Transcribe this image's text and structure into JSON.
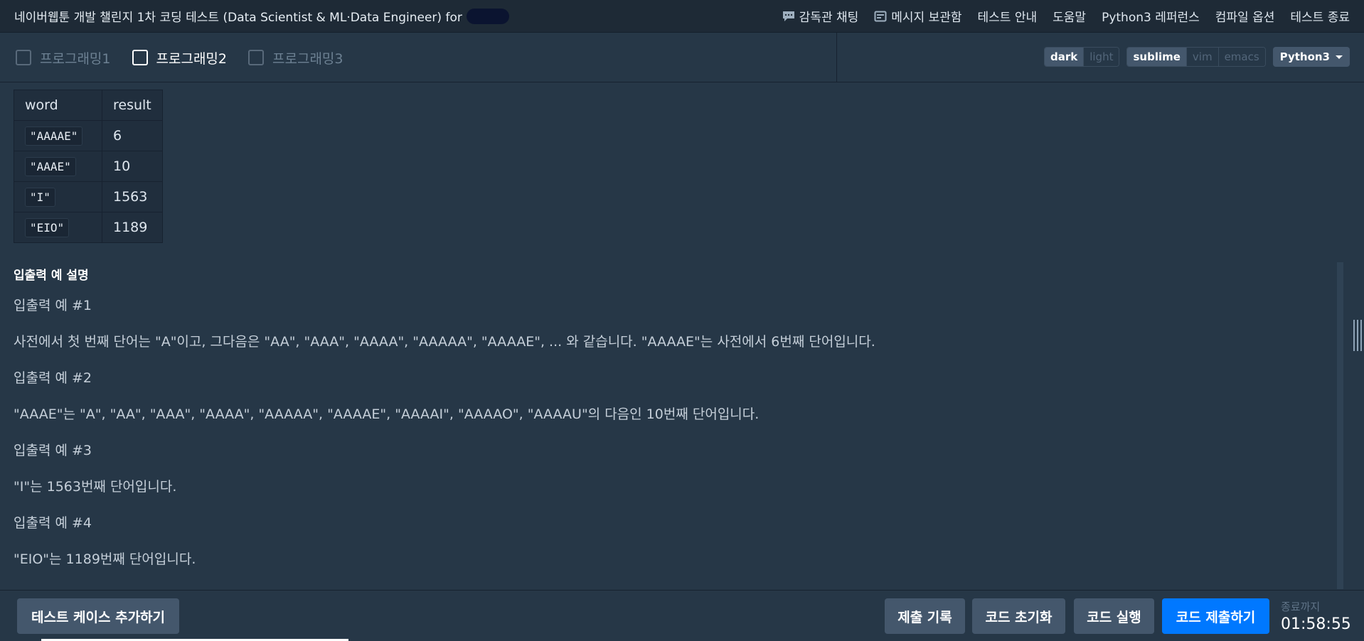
{
  "header": {
    "title": "네이버웹툰 개발 챌린지 1차 코딩 테스트 (Data Scientist & ML·Data Engineer) for",
    "nav": [
      {
        "label": "감독관 채팅",
        "icon": "chat-icon"
      },
      {
        "label": "메시지 보관함",
        "icon": "inbox-icon"
      },
      {
        "label": "테스트 안내",
        "icon": ""
      },
      {
        "label": "도움말",
        "icon": ""
      },
      {
        "label": "Python3 레퍼런스",
        "icon": ""
      },
      {
        "label": "컴파일 옵션",
        "icon": ""
      },
      {
        "label": "테스트 종료",
        "icon": ""
      }
    ]
  },
  "tabs": [
    {
      "label": "프로그래밍1",
      "active": false
    },
    {
      "label": "프로그래밍2",
      "active": true
    },
    {
      "label": "프로그래밍3",
      "active": false
    }
  ],
  "editor_options": {
    "theme": [
      "dark",
      "light"
    ],
    "theme_selected": "dark",
    "keymap": [
      "sublime",
      "vim",
      "emacs"
    ],
    "keymap_selected": "sublime",
    "language": "Python3"
  },
  "table": {
    "headers": [
      "word",
      "result"
    ],
    "rows": [
      [
        "\"AAAAE\"",
        "6"
      ],
      [
        "\"AAAE\"",
        "10"
      ],
      [
        "\"I\"",
        "1563"
      ],
      [
        "\"EIO\"",
        "1189"
      ]
    ]
  },
  "description": {
    "heading": "입출력 예 설명",
    "examples": [
      {
        "title": "입출력 예 #1",
        "text": "사전에서 첫 번째 단어는 \"A\"이고, 그다음은 \"AA\", \"AAA\", \"AAAA\", \"AAAAA\", \"AAAAE\", ... 와 같습니다. \"AAAAE\"는 사전에서 6번째 단어입니다."
      },
      {
        "title": "입출력 예 #2",
        "text": "\"AAAE\"는 \"A\", \"AA\", \"AAA\", \"AAAA\", \"AAAAA\", \"AAAAE\", \"AAAAI\", \"AAAAO\", \"AAAAU\"의 다음인 10번째 단어입니다."
      },
      {
        "title": "입출력 예 #3",
        "text": "\"I\"는 1563번째 단어입니다."
      },
      {
        "title": "입출력 예 #4",
        "text": "\"EIO\"는 1189번째 단어입니다."
      }
    ]
  },
  "bottom": {
    "add_testcase": "테스트 케이스 추가하기",
    "submit_history": "제출 기록",
    "reset_code": "코드 초기화",
    "run_code": "코드 실행",
    "submit_code": "코드 제출하기",
    "timer_label": "종료까지",
    "timer_value": "01:58:55"
  },
  "colors": {
    "background": "#263747",
    "header": "#1e2a36",
    "primary": "#0078ff",
    "button": "#44576c"
  }
}
